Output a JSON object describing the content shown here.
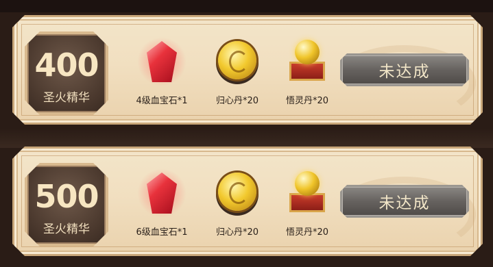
{
  "tiers": [
    {
      "points": "400",
      "points_label": "圣火精华",
      "rewards": [
        {
          "icon": "red-gem-icon",
          "label": "4级血宝石*1"
        },
        {
          "icon": "gold-medal-icon",
          "label": "归心丹*20"
        },
        {
          "icon": "golden-orb-chest-icon",
          "label": "悟灵丹*20"
        }
      ],
      "status": "未达成"
    },
    {
      "points": "500",
      "points_label": "圣火精华",
      "rewards": [
        {
          "icon": "red-gem-icon",
          "label": "6级血宝石*1"
        },
        {
          "icon": "gold-medal-icon",
          "label": "归心丹*20"
        },
        {
          "icon": "golden-orb-chest-icon",
          "label": "悟灵丹*20"
        }
      ],
      "status": "未达成"
    }
  ],
  "colors": {
    "card_bg": "#f1dfc0",
    "badge_bg": "#4a382d",
    "button_bg": "#66625f",
    "text_light": "#f2e6c8"
  }
}
